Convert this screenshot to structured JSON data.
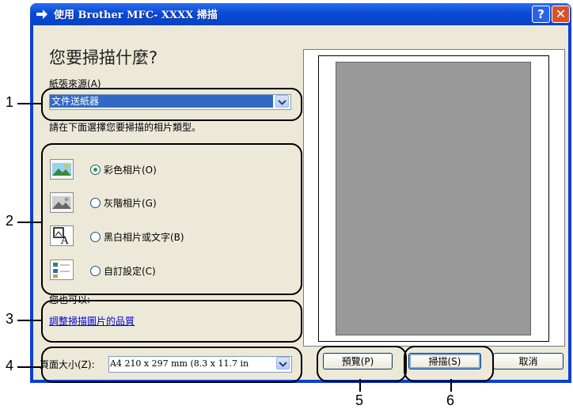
{
  "window": {
    "title": "使用 Brother MFC- XXXX  掃描",
    "help": "?",
    "close": "✕"
  },
  "form": {
    "question": "您要掃描什麼?",
    "source_label": "紙張來源(A)",
    "source_value": "文件送紙器",
    "type_instruction": "請在下面選擇您要掃描的相片類型。",
    "options": [
      {
        "label": "彩色相片(O)",
        "icon": "color-photo-icon",
        "selected": true
      },
      {
        "label": "灰階相片(G)",
        "icon": "grayscale-photo-icon",
        "selected": false
      },
      {
        "label": "黑白相片或文字(B)",
        "icon": "bw-text-icon",
        "selected": false
      },
      {
        "label": "自訂設定(C)",
        "icon": "custom-settings-icon",
        "selected": false
      }
    ],
    "also_label": "您也可以:",
    "quality_link": "調整掃描圖片的品質",
    "pagesize_label": "頁面大小(Z):",
    "pagesize_value": "A4 210 x 297 mm (8.3 x 11.7 in"
  },
  "buttons": {
    "preview": "預覽(P)",
    "scan": "掃描(S)",
    "cancel": "取消"
  },
  "callouts": [
    "1",
    "2",
    "3",
    "4",
    "5",
    "6"
  ],
  "colors": {
    "titlebar": "#0a4ad6",
    "selection": "#316ac5",
    "link": "#0000cc",
    "preview_fill": "#999999"
  }
}
